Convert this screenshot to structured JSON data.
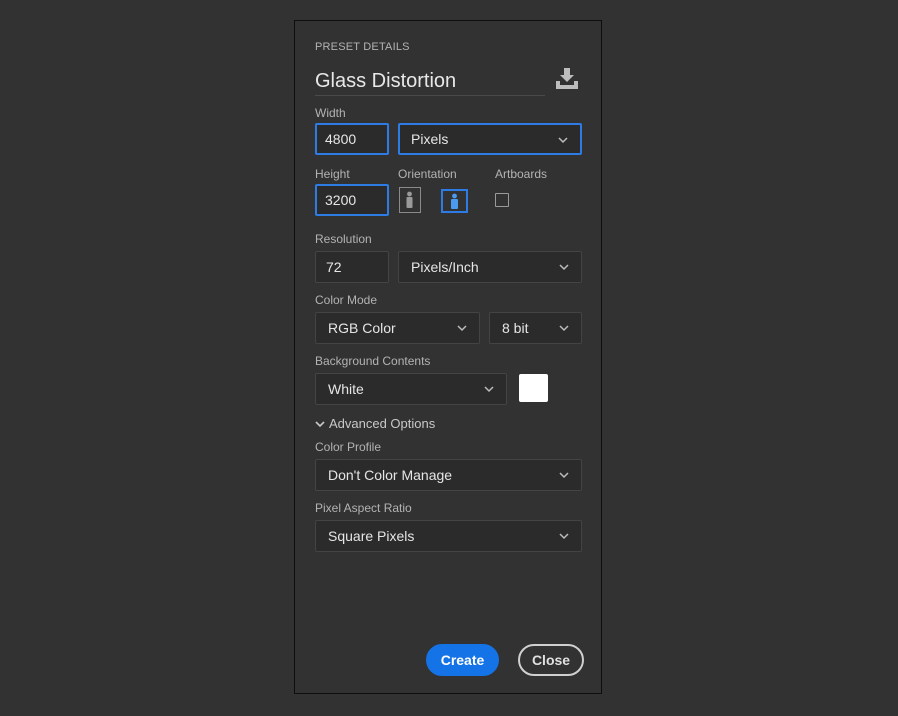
{
  "panel": {
    "section_title": "PRESET DETAILS",
    "preset_name": "Glass Distortion"
  },
  "width": {
    "label": "Width",
    "value": "4800",
    "unit": "Pixels"
  },
  "height": {
    "label": "Height",
    "value": "3200"
  },
  "orientation": {
    "label": "Orientation",
    "selected": "landscape"
  },
  "artboards": {
    "label": "Artboards",
    "checked": false
  },
  "resolution": {
    "label": "Resolution",
    "value": "72",
    "unit": "Pixels/Inch"
  },
  "color_mode": {
    "label": "Color Mode",
    "mode": "RGB Color",
    "depth": "8 bit"
  },
  "background": {
    "label": "Background Contents",
    "value": "White",
    "swatch_color": "#ffffff"
  },
  "advanced": {
    "toggle_label": "Advanced Options",
    "color_profile": {
      "label": "Color Profile",
      "value": "Don't Color Manage"
    },
    "pixel_aspect": {
      "label": "Pixel Aspect Ratio",
      "value": "Square Pixels"
    }
  },
  "actions": {
    "create_label": "Create",
    "close_label": "Close"
  },
  "colors": {
    "accent": "#1473e6",
    "focus_border": "#2d7be5",
    "background": "#323232"
  },
  "icons": {
    "save": "save-preset-icon",
    "chevron": "chevron-down-icon"
  }
}
